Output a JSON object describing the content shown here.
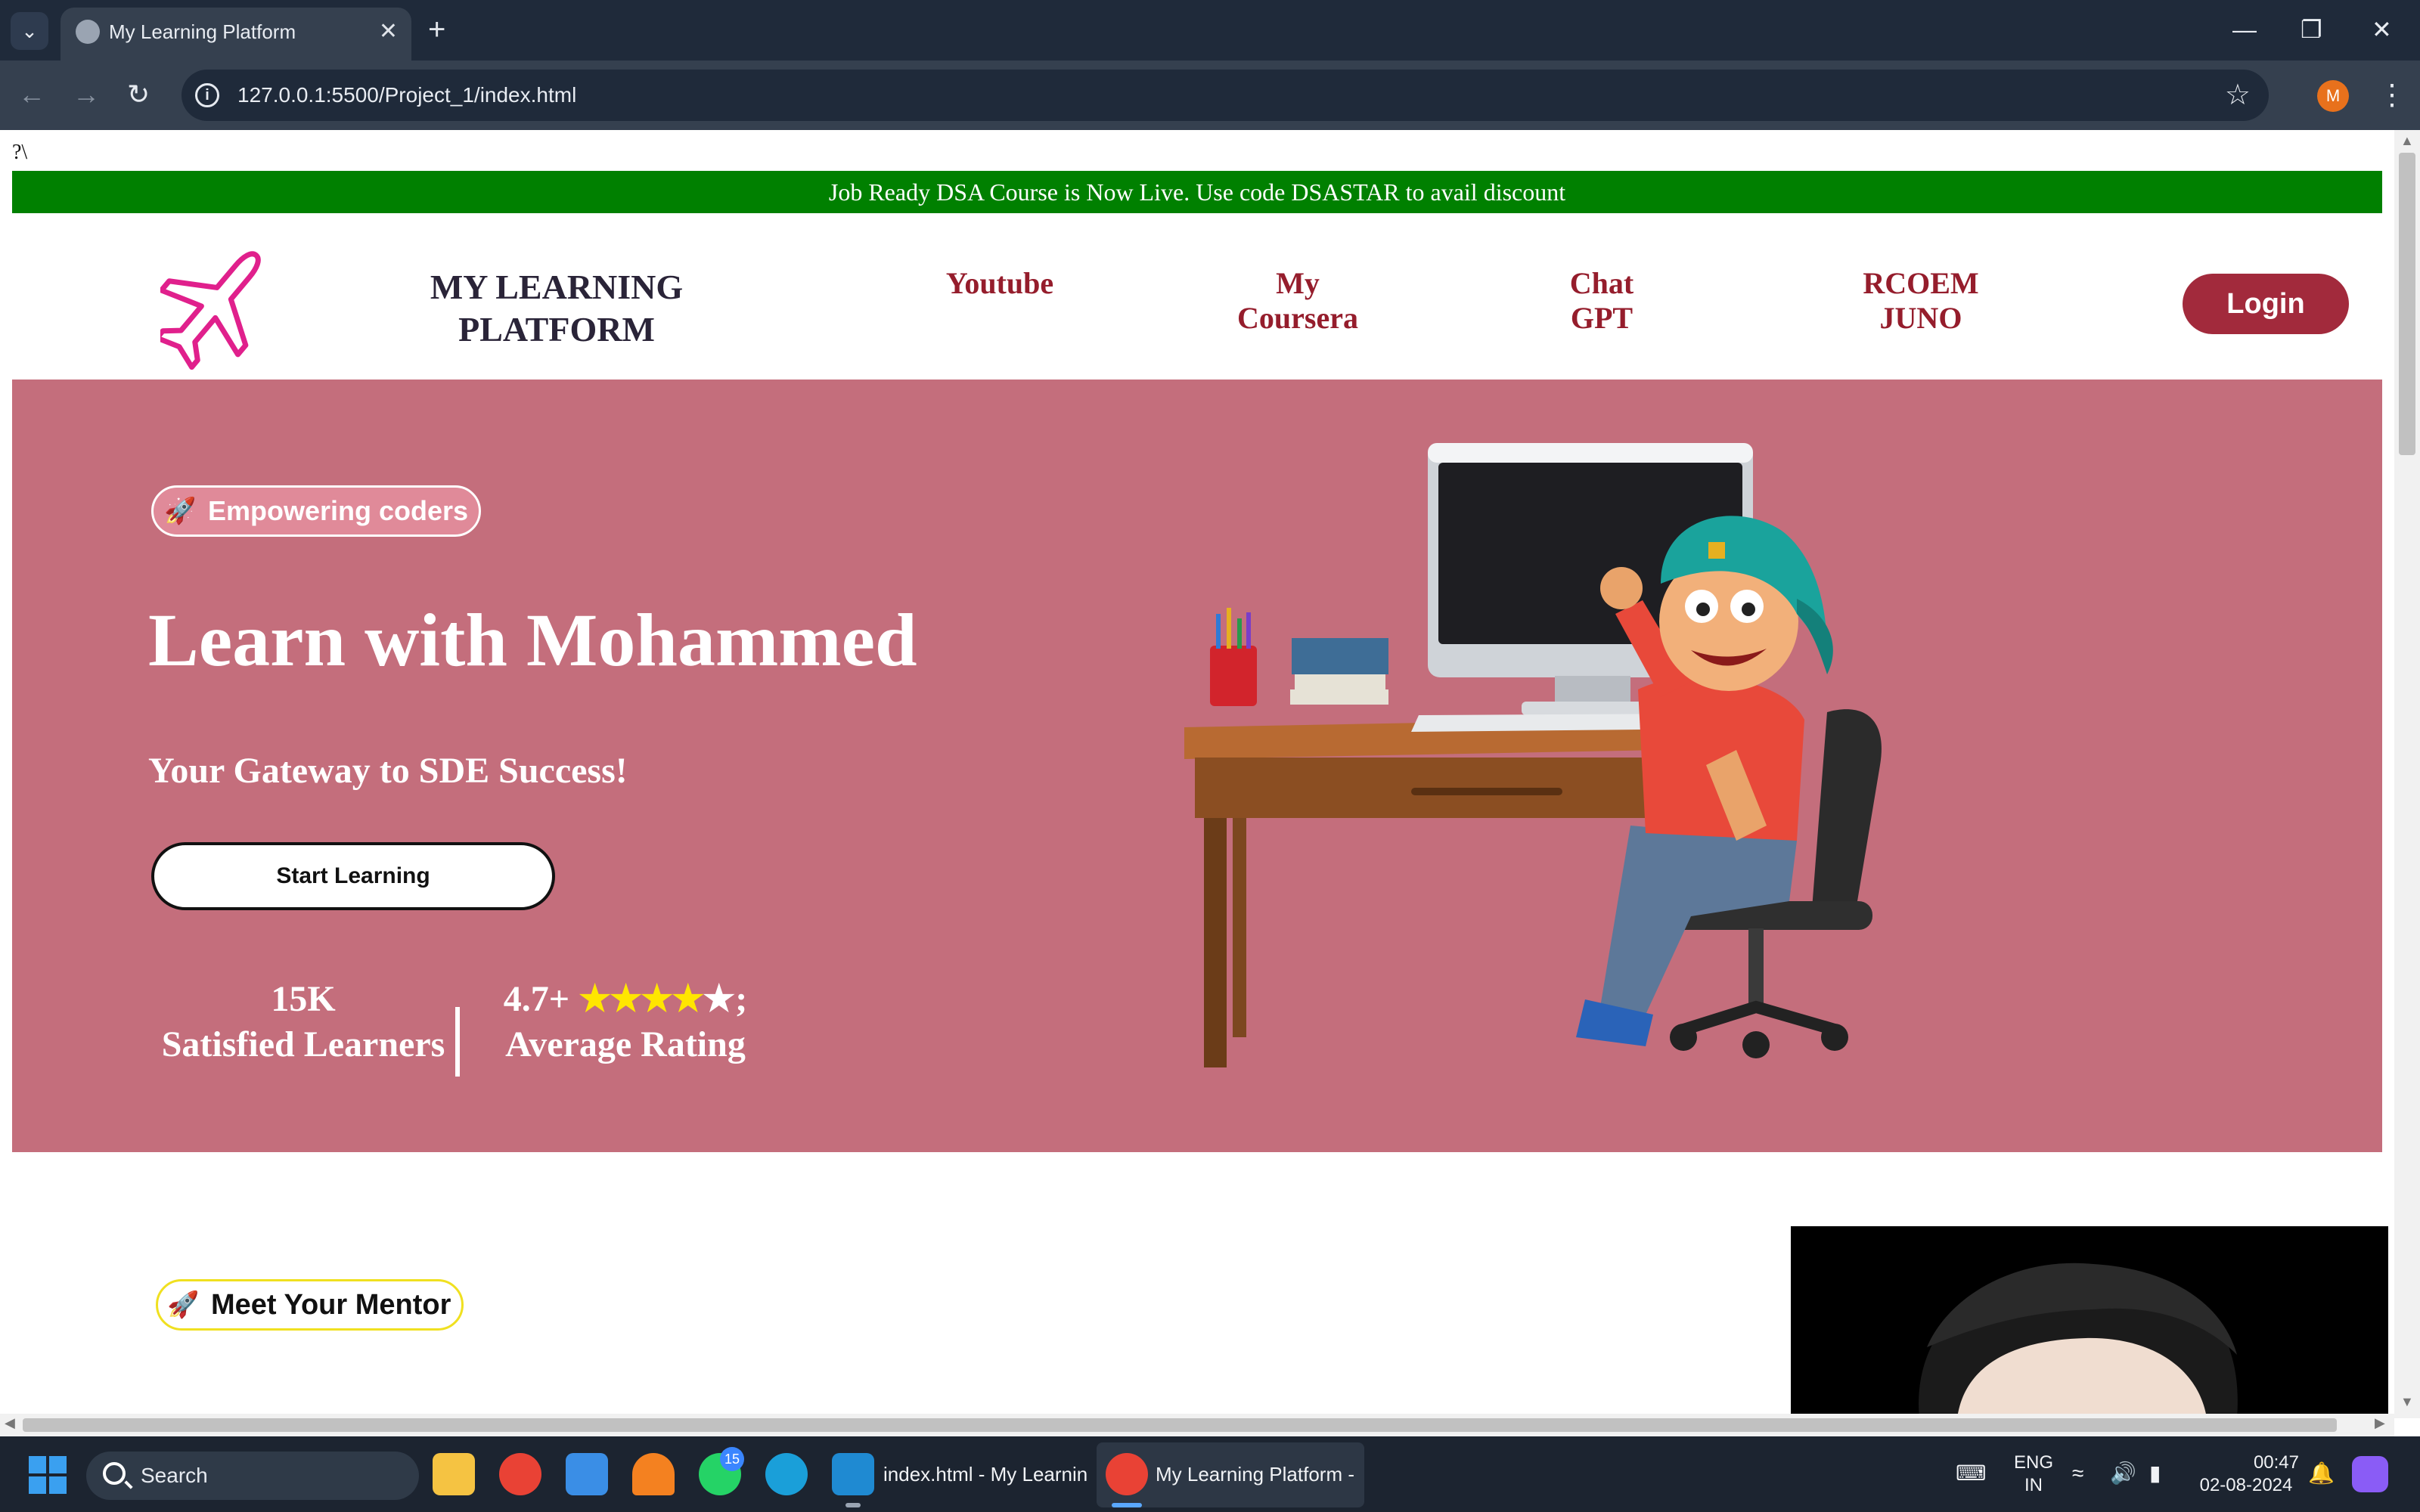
{
  "browser": {
    "tab_title": "My Learning Platform",
    "tab_close": "✕",
    "new_tab": "+",
    "tab_list": "⌄",
    "url": "127.0.0.1:5500/Project_1/index.html",
    "profile_initial": "M",
    "window_controls": [
      "—",
      "❐",
      "✕"
    ]
  },
  "page": {
    "stray_text": "?\\",
    "announcement": "Job Ready DSA Course is Now Live. Use code DSASTAR to avail discount",
    "header": {
      "brand_line1": "MY LEARNING",
      "brand_line2": "PLATFORM",
      "nav": [
        {
          "line1": "Youtube",
          "line2": ""
        },
        {
          "line1": "My",
          "line2": "Coursera"
        },
        {
          "line1": "Chat",
          "line2": "GPT"
        },
        {
          "line1": "RCOEM",
          "line2": "JUNO"
        }
      ],
      "login": "Login"
    },
    "hero": {
      "badge": "Empowering coders",
      "title": "Learn with Mohammed",
      "subtitle": "Your Gateway to SDE Success!",
      "cta": "Start Learning",
      "stat1_value": "15K",
      "stat1_label": "Satisfied Learners",
      "stat2_value": "4.7+",
      "stat2_stars": "★★★★",
      "stat2_star_empty": "★",
      "stat2_suffix": ";",
      "stat2_label": "Average Rating",
      "rating_stars_filled": 4,
      "rating_stars_total": 5
    },
    "mentor": {
      "badge": "Meet Your Mentor"
    }
  },
  "taskbar": {
    "search": "Search",
    "whatsapp_badge": "15",
    "vscode_label": "index.html - My Learnin",
    "chrome_label": "My Learning Platform -",
    "lang_line1": "ENG",
    "lang_line2": "IN",
    "time": "00:47",
    "date": "02-08-2024"
  },
  "colors": {
    "announcement_bg": "#008000",
    "hero_bg": "#c46e7c",
    "nav_text": "#951d2c",
    "login_bg": "#a22a3c",
    "logo_stroke": "#e0208c"
  }
}
